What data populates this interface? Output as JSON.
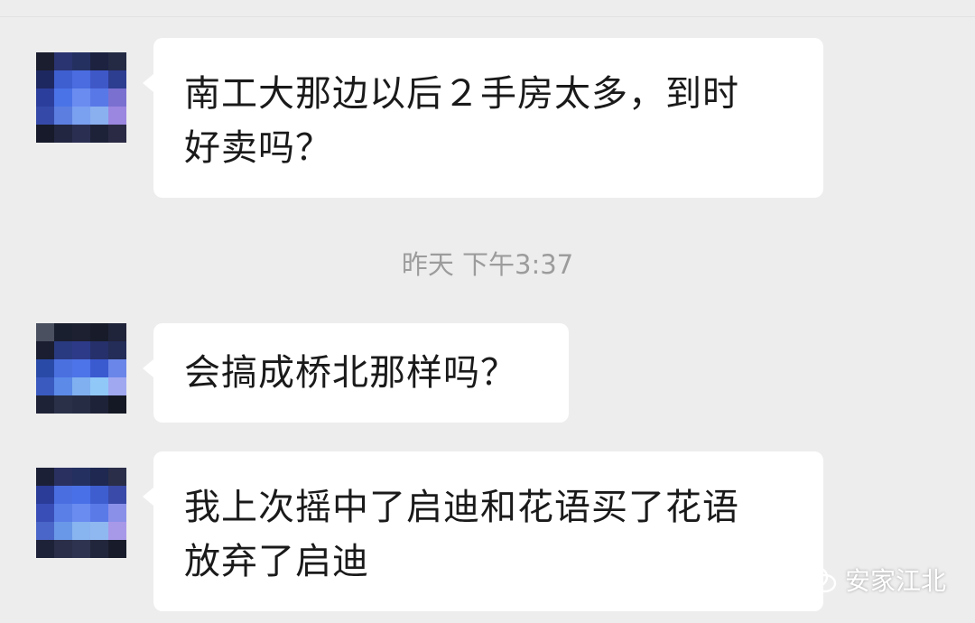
{
  "messages": [
    {
      "text_line1": "南工大那边以后２手房太多，到时",
      "text_line2": "好卖吗？"
    },
    {
      "text_line1": "会搞成桥北那样吗？"
    },
    {
      "text_line1": "我上次摇中了启迪和花语买了花语",
      "text_line2": "放弃了启迪"
    }
  ],
  "timestamp": "昨天 下午3:37",
  "watermark": {
    "label": "安家江北",
    "icon": "wechat-icon"
  },
  "colors": {
    "background": "#ededed",
    "bubble": "#ffffff",
    "text": "#1a1a1a",
    "timestamp": "#9c9c9c"
  }
}
